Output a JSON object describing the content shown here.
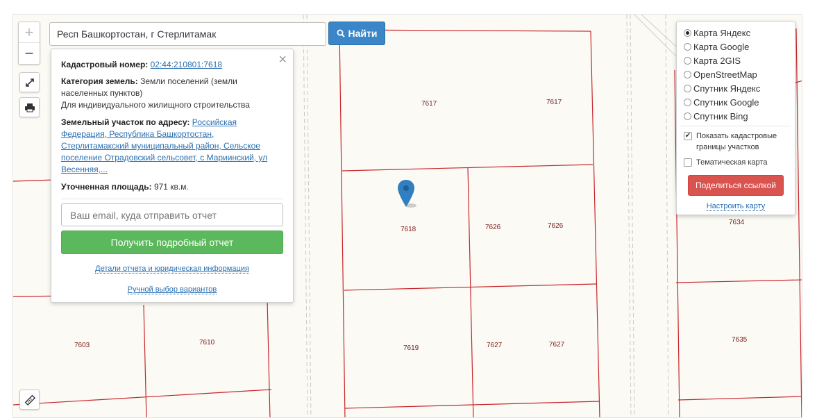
{
  "search": {
    "value": "Респ Башкортостан, г Стерлитамак",
    "button_label": "Найти"
  },
  "zoom": {
    "in_label": "+",
    "out_label": "−"
  },
  "info": {
    "cadastral_label": "Кадастровый номер:",
    "cadastral_value": "02:44:210801:7618",
    "category_label": "Категория земель:",
    "category_value": "Земли поселений (земли населенных пунктов)",
    "usage": "Для индивидуального жилищного строительства",
    "address_label": "Земельный участок по адресу:",
    "address_value": "Российская Федерация, Республика Башкортостан, Стерлитамакский муниципальный район, Сельское поселение Отрадовский сельсовет, с Мариинский, ул Весенняя,...",
    "area_label": "Уточненная площадь:",
    "area_value": "971 кв.м.",
    "email_placeholder": "Ваш email, куда отправить отчет",
    "report_button": "Получить подробный отчет",
    "details_link": "Детали отчета и юридическая информация",
    "manual_link": "Ручной выбор вариантов",
    "close_glyph": "×"
  },
  "layers": {
    "options": [
      {
        "label": "Карта Яндекс",
        "selected": true
      },
      {
        "label": "Карта Google",
        "selected": false
      },
      {
        "label": "Карта 2GIS",
        "selected": false
      },
      {
        "label": "OpenStreetMap",
        "selected": false
      },
      {
        "label": "Спутник Яндекс",
        "selected": false
      },
      {
        "label": "Спутник Google",
        "selected": false
      },
      {
        "label": "Спутник Bing",
        "selected": false
      }
    ],
    "show_borders_label": "Показать кадастровые границы участков",
    "show_borders_checked": true,
    "thematic_label": "Тематическая карта",
    "thematic_checked": false,
    "share_button": "Поделиться ссылкой",
    "configure_link": "Настроить карту"
  },
  "plot_labels": [
    "7617",
    "7617",
    "7618",
    "7626",
    "7626",
    "7603",
    "7610",
    "7619",
    "7627",
    "7627",
    "7634",
    "7635"
  ],
  "colors": {
    "plot_border": "#c8262c",
    "pin": "#2f7fc1",
    "accent": "#3a86c8"
  }
}
